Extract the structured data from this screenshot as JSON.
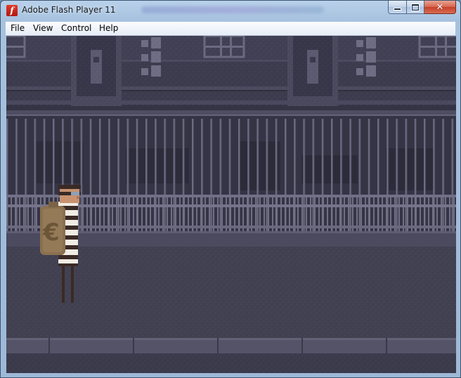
{
  "window": {
    "title": "Adobe Flash Player 11"
  },
  "titlebar": {
    "icon": "flash-player-icon"
  },
  "caption_buttons": {
    "minimize": "minimize-icon",
    "maximize": "maximize-icon",
    "close": "close-icon"
  },
  "menu": {
    "items": [
      "File",
      "View",
      "Control",
      "Help"
    ]
  },
  "scene": {
    "icons": [
      "building-facade",
      "iron-fence",
      "sidewalk",
      "thief-character",
      "euro-money-bag-icon"
    ],
    "bag_symbol": "€",
    "colors": {
      "sky_wall": "#3a384a",
      "fence": "#6e6e84",
      "street": "#413f52",
      "curb": "#555468"
    }
  }
}
